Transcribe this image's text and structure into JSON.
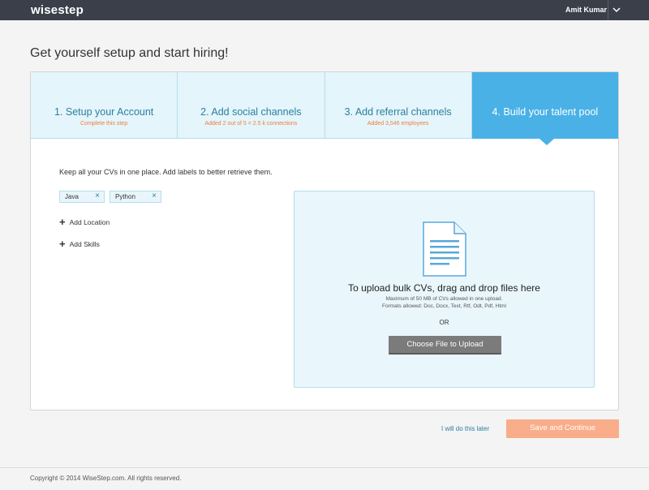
{
  "header": {
    "logo": "wisestep",
    "user_name": "Amit Kumar",
    "dropdown_icon": "chevron-down-icon"
  },
  "page": {
    "title": "Get yourself setup and start hiring!"
  },
  "steps": [
    {
      "title": "1. Setup your Account",
      "subtitle": "Complete this step",
      "active": false
    },
    {
      "title": "2. Add social channels",
      "subtitle": "Added 2 out of 5 = 2.5 k connections",
      "active": false
    },
    {
      "title": "3. Add referral channels",
      "subtitle": "Added 3,546 employees",
      "active": false
    },
    {
      "title": "4. Build your talent pool",
      "subtitle": "",
      "active": true
    }
  ],
  "talent_pool": {
    "intro": "Keep all your CVs in one place. Add labels to better retrieve them.",
    "tags": [
      {
        "label": "Java",
        "remove_icon": "close-icon"
      },
      {
        "label": "Python",
        "remove_icon": "close-icon"
      }
    ],
    "add_location": "Add Location",
    "add_skills": "Add Skills"
  },
  "upload": {
    "icon": "document-icon",
    "title": "To upload bulk CVs, drag and drop files here",
    "note_1": "Maximum of 50 MB of CVs allowed in one upload.",
    "note_2": "Formats allowed: Doc, Docx, Text, Rtf, Odt, Pdf, Html",
    "or": "OR",
    "button": "Choose File to Upload"
  },
  "actions": {
    "later": "I will do this later",
    "save": "Save and Continue"
  },
  "footer": {
    "copyright": "Copyright © 2014 WiseStep.com. All rights reserved."
  },
  "colors": {
    "topbar": "#3a3f4a",
    "active_step": "#49b1e6",
    "step_bg": "#e4f5fb",
    "accent_orange": "#f07d3c",
    "save_button": "#f9ad8a",
    "upload_button": "#7b7b7b"
  }
}
